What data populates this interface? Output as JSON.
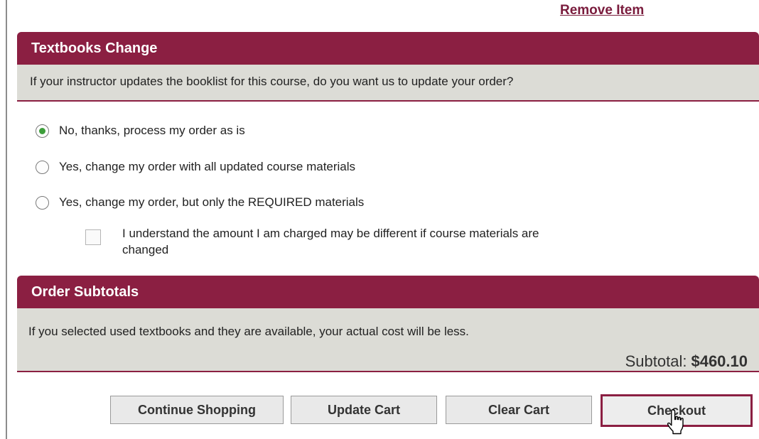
{
  "remove_link": "Remove Item",
  "textbooks_change": {
    "header": "Textbooks Change",
    "question": "If your instructor updates the booklist for this course, do you want us to update your order?",
    "options": [
      {
        "label": "No, thanks, process my order as is",
        "selected": true
      },
      {
        "label": "Yes, change my order with all updated course materials",
        "selected": false
      },
      {
        "label": "Yes, change my order, but only the REQUIRED materials",
        "selected": false
      }
    ],
    "acknowledge_line1": "I understand the amount I am charged may be different if course materials are",
    "acknowledge_line2": "changed"
  },
  "order_subtotals": {
    "header": "Order Subtotals",
    "note": "If you selected used textbooks and they are available, your actual cost will be less.",
    "subtotal_label": "Subtotal:",
    "subtotal_value": "$460.10"
  },
  "buttons": {
    "continue": "Continue Shopping",
    "update": "Update Cart",
    "clear": "Clear Cart",
    "checkout": "Checkout"
  },
  "colors": {
    "header_bg": "#8b1f42",
    "sub_bg": "#dcdcd6",
    "radio_selected": "#3d9e3b"
  },
  "icons": {
    "cursor": "hand-pointer-icon"
  }
}
